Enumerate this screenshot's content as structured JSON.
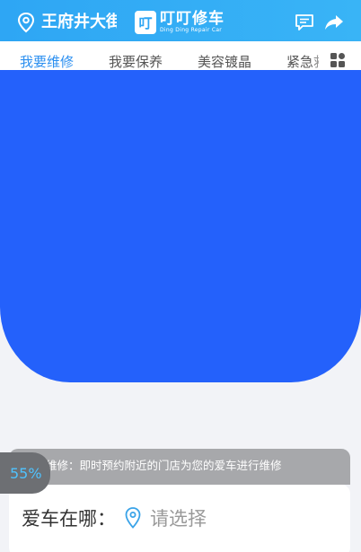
{
  "header": {
    "location": "王府井大街",
    "logo_mark": "叮",
    "logo_text": "叮叮修车",
    "logo_subtitle": "Ding Ding Repair Car",
    "icons": {
      "location": "location-pin-icon",
      "message": "message-icon",
      "share": "share-icon"
    }
  },
  "tabs": [
    {
      "label": "我要维修",
      "active": true
    },
    {
      "label": "我要保养",
      "active": false
    },
    {
      "label": "美容镀晶",
      "active": false
    },
    {
      "label": "紧急救援",
      "active": false
    }
  ],
  "grid_icon": "grid-menu-icon",
  "banner": {
    "color": "#2461fb"
  },
  "notice": {
    "text": "我要维修：即时预约附近的门店为您的爱车进行维修"
  },
  "car_location": {
    "label": "爱车在哪：",
    "placeholder": "请选择"
  },
  "progress_badge": {
    "text": "55%"
  },
  "colors": {
    "header": "#2ea6f4",
    "accent": "#2b8ff0",
    "banner": "#2461fb"
  }
}
